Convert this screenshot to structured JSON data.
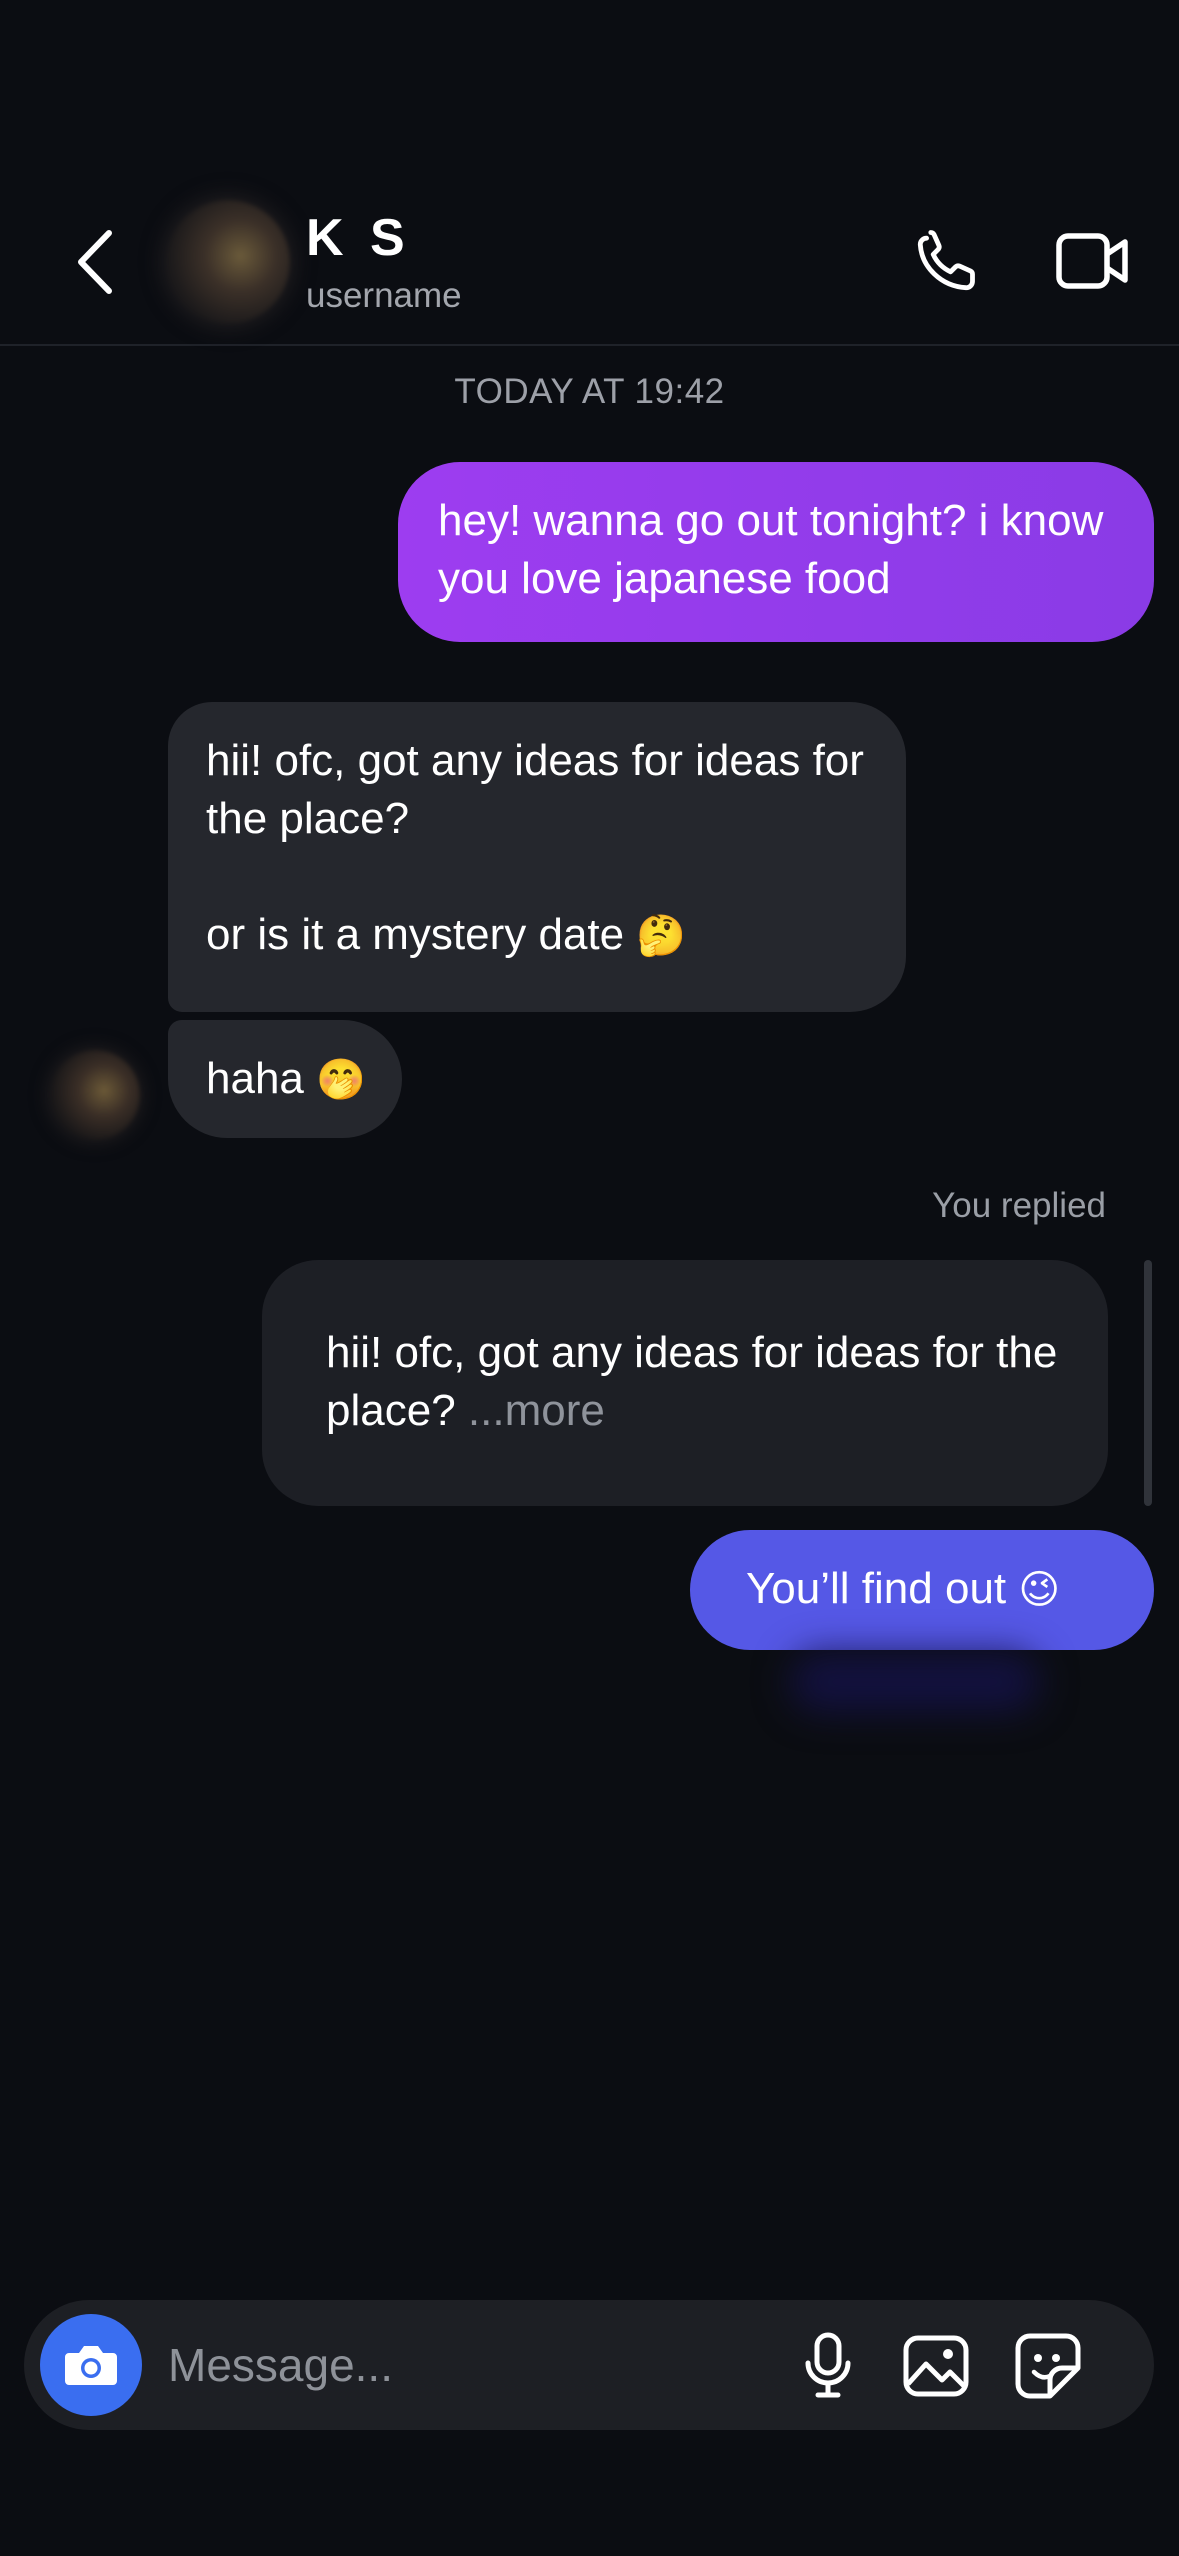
{
  "header": {
    "name": "K S",
    "username": "username"
  },
  "chat": {
    "timestamp": "TODAY AT 19:42",
    "messages": [
      {
        "sender": "me",
        "text": "hey! wanna go out tonight? i know you love japanese food"
      },
      {
        "sender": "them",
        "line1": "hii! ofc, got any ideas for ideas for the place?",
        "line2": "or is it a mystery date",
        "emoji": "🤔"
      },
      {
        "sender": "them",
        "text": "haha",
        "emoji": "🤭"
      },
      {
        "sender": "me",
        "text": "You’ll find out",
        "emoji": "😉"
      }
    ],
    "reply": {
      "label": "You replied",
      "quote": "hii! ofc, got any ideas for ideas for the place?",
      "more": "...more"
    }
  },
  "composer": {
    "placeholder": "Message..."
  },
  "colors": {
    "background": "#0b0d12",
    "outgoing_gradient": "#9d3df0",
    "outgoing_blue": "#5558e6",
    "incoming": "#25272d",
    "camera": "#3a6ef0"
  }
}
